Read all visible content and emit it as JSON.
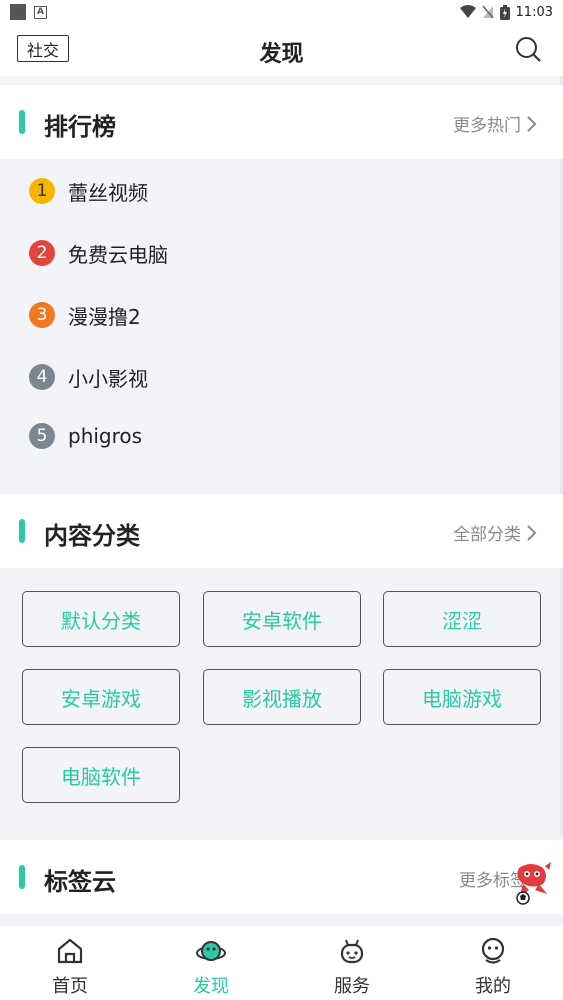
{
  "status_bar": {
    "time": "11:03"
  },
  "header": {
    "social_label": "社交",
    "title": "发现"
  },
  "ranking": {
    "title": "排行榜",
    "more_label": "更多热门",
    "items": [
      {
        "rank": "1",
        "name": "蕾丝视频",
        "color": "#f7b500"
      },
      {
        "rank": "2",
        "name": "免费云电脑",
        "color": "#e2453d"
      },
      {
        "rank": "3",
        "name": "漫漫撸2",
        "color": "#f0781e"
      },
      {
        "rank": "4",
        "name": "小小影视",
        "color": "#7d8690"
      },
      {
        "rank": "5",
        "name": "phigros",
        "color": "#7d8690"
      }
    ]
  },
  "categories": {
    "title": "内容分类",
    "more_label": "全部分类",
    "items": [
      "默认分类",
      "安卓软件",
      "涩涩",
      "安卓游戏",
      "影视播放",
      "电脑游戏",
      "电脑软件"
    ]
  },
  "tags": {
    "title": "标签云",
    "more_label": "更多标签"
  },
  "tabbar": {
    "items": [
      {
        "label": "首页",
        "icon": "home-icon"
      },
      {
        "label": "发现",
        "icon": "discover-planet-icon"
      },
      {
        "label": "服务",
        "icon": "service-robot-icon"
      },
      {
        "label": "我的",
        "icon": "profile-face-icon"
      }
    ],
    "active_index": 1
  },
  "colors": {
    "accent": "#2bc9a6",
    "text": "#222222",
    "muted": "#8a8a8a",
    "background": "#f3f4f8"
  }
}
